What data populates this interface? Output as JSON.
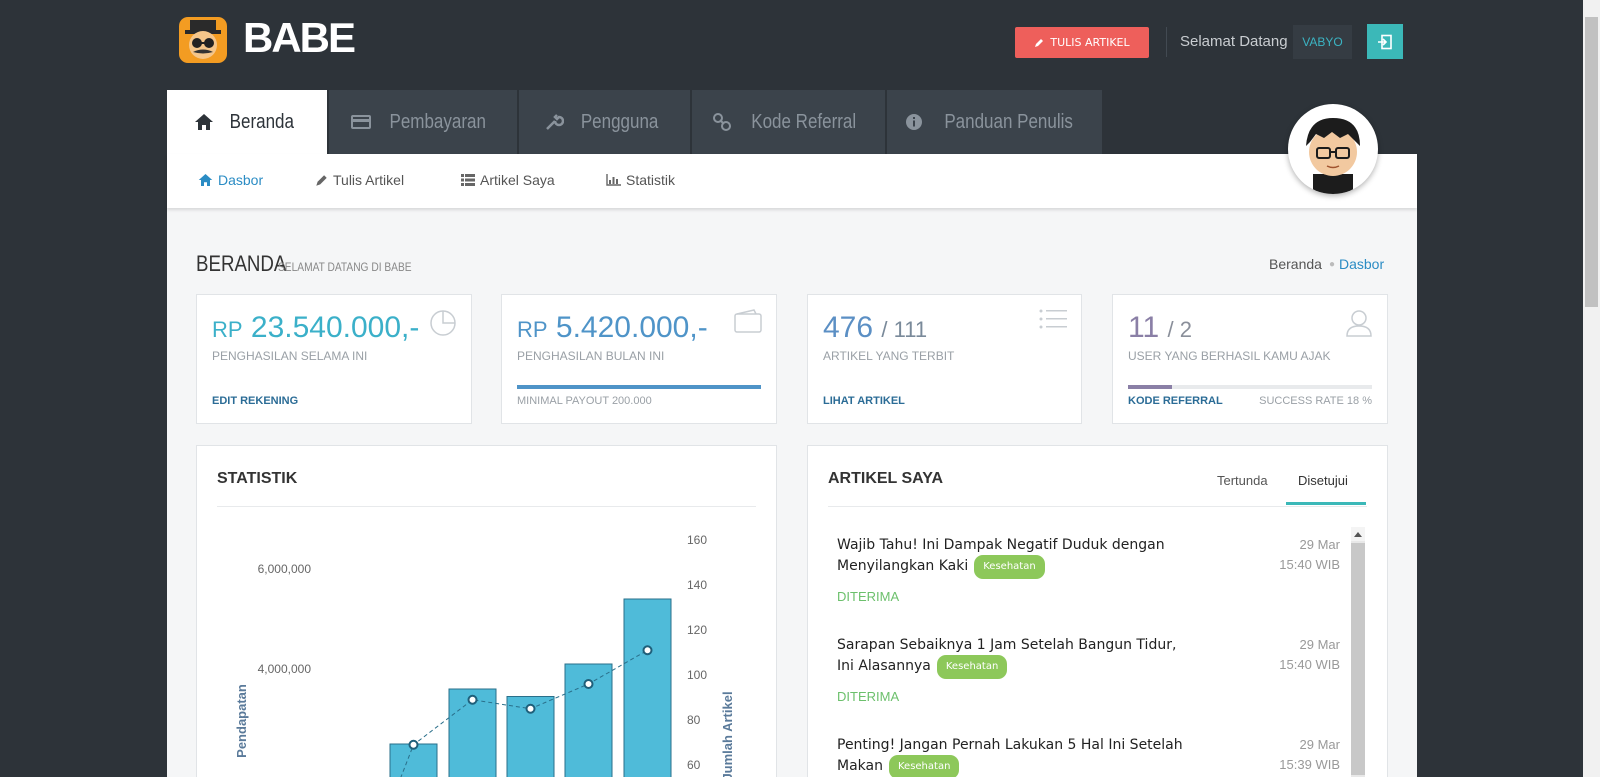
{
  "brand": {
    "name": "BABE"
  },
  "topbar": {
    "write_button": "TULIS ARTIKEL",
    "welcome": "Selamat Datang",
    "username": "VABYO"
  },
  "tabs": [
    {
      "label": "Beranda",
      "icon": "home-icon",
      "active": true
    },
    {
      "label": "Pembayaran",
      "icon": "credit-card-icon"
    },
    {
      "label": "Pengguna",
      "icon": "wrench-icon"
    },
    {
      "label": "Kode Referral",
      "icon": "link-icon"
    },
    {
      "label": "Panduan Penulis",
      "icon": "info-icon"
    }
  ],
  "subnav": [
    {
      "label": "Dasbor",
      "icon": "home-icon",
      "active": true
    },
    {
      "label": "Tulis Artikel",
      "icon": "pencil-icon"
    },
    {
      "label": "Artikel Saya",
      "icon": "list-icon"
    },
    {
      "label": "Statistik",
      "icon": "bar-chart-icon"
    }
  ],
  "page": {
    "title": "BERANDA",
    "subtitle": "SELAMAT DATANG DI BABE",
    "breadcrumb": [
      "Beranda",
      "Dasbor"
    ]
  },
  "cards": [
    {
      "prefix": "RP",
      "value": "23.540.000,-",
      "label": "PENGHASILAN SELAMA INI",
      "footer": "EDIT REKENING",
      "color": "#3bb0c9",
      "icon": "pie-chart-icon"
    },
    {
      "prefix": "RP",
      "value": "5.420.000,-",
      "label": "PENGHASILAN BULAN INI",
      "footer": "MINIMAL PAYOUT 200.000",
      "progress": 1.0,
      "color": "#4f94c8",
      "icon": "wallet-icon"
    },
    {
      "value": "476",
      "suffix": "/ 111",
      "label": "ARTIKEL YANG TERBIT",
      "footer": "LIHAT ARTIKEL",
      "color": "#5b8fc4",
      "icon": "list-icon"
    },
    {
      "value": "11",
      "suffix": "/ 2",
      "label": "USER YANG BERHASIL KAMU AJAK",
      "footer": "KODE REFERRAL",
      "footer_right": "SUCCESS RATE 18 %",
      "progress": 0.18,
      "color": "#8a7fa6",
      "icon": "user-icon"
    }
  ],
  "statistik": {
    "title": "STATISTIK",
    "ylabel_left": "Pendapatan",
    "ylabel_right": "Jumlah Artikel",
    "left_ticks": [
      "6,000,000",
      "4,000,000"
    ],
    "right_ticks": [
      "160",
      "140",
      "120",
      "100",
      "80",
      "60"
    ]
  },
  "chart_data": {
    "type": "bar",
    "ylabel": "Pendapatan",
    "y2label": "Jumlah Artikel",
    "series": [
      {
        "type": "bar",
        "values": [
          2500000,
          3600000,
          3450000,
          4100000,
          5400000
        ]
      },
      {
        "type": "line",
        "values": [
          69,
          89,
          85,
          96,
          111
        ]
      }
    ],
    "y2lim": [
      60,
      160
    ]
  },
  "artikel": {
    "title": "ARTIKEL SAYA",
    "tabs": [
      "Tertunda",
      "Disetujui"
    ],
    "items": [
      {
        "title": "Wajib Tahu! Ini Dampak Negatif Duduk dengan Menyilangkan Kaki",
        "tag": "Kesehatan",
        "status": "DITERIMA",
        "date": "29 Mar",
        "time": "15:40 WIB"
      },
      {
        "title": "Sarapan Sebaiknya 1 Jam Setelah Bangun Tidur, Ini Alasannya",
        "tag": "Kesehatan",
        "status": "DITERIMA",
        "date": "29 Mar",
        "time": "15:40 WIB"
      },
      {
        "title": "Penting! Jangan Pernah Lakukan 5 Hal Ini Setelah Makan",
        "tag": "Kesehatan",
        "status": "",
        "date": "29 Mar",
        "time": "15:39 WIB"
      }
    ]
  }
}
